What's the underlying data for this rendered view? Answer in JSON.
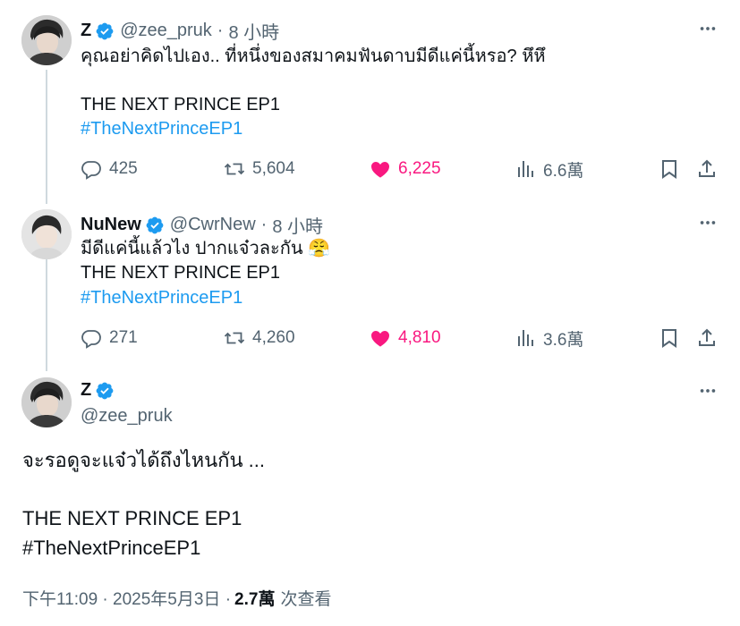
{
  "tweets": [
    {
      "name": "Z",
      "handle": "@zee_pruk",
      "time": "8 小時",
      "dot": "·",
      "lines": [
        "คุณอย่าคิดไปเอง.. ที่หนึ่งของสมาคมฟันดาบมีดีแค่นี้หรอ? หึหึ"
      ],
      "show_title": "THE NEXT PRINCE EP1",
      "hashtag": "#TheNextPrinceEP1",
      "replies": "425",
      "reposts": "5,604",
      "likes": "6,225",
      "views": "6.6萬"
    },
    {
      "name": "NuNew",
      "handle": "@CwrNew",
      "time": "8 小時",
      "dot": "·",
      "lines": [
        "มีดีแค่นี้แล้วไง ปากแจ๋วละกัน 😤"
      ],
      "show_title": "THE NEXT PRINCE EP1",
      "hashtag": "#TheNextPrinceEP1",
      "replies": "271",
      "reposts": "4,260",
      "likes": "4,810",
      "views": "3.6萬"
    }
  ],
  "main": {
    "name": "Z",
    "handle": "@zee_pruk",
    "line1": "จะรอดูจะแจ๋วได้ถึงไหนกัน ...",
    "show_title": "THE NEXT PRINCE EP1",
    "hashtag": "#TheNextPrinceEP1",
    "timestamp": "下午11:09 · 2025年5月3日 ·",
    "views": "2.7萬",
    "views_label": "次查看"
  },
  "colors": {
    "accent": "#1d9bf0",
    "like": "#f91880",
    "secondary_text": "#536471",
    "connector": "#cfd9de"
  },
  "icons": {
    "verified": "verified-badge-icon",
    "more": "more-dots-icon",
    "reply": "reply-bubble-icon",
    "repost": "repost-arrows-icon",
    "like": "heart-filled-icon",
    "views": "bar-chart-icon",
    "bookmark": "bookmark-icon",
    "share": "share-upload-icon"
  }
}
